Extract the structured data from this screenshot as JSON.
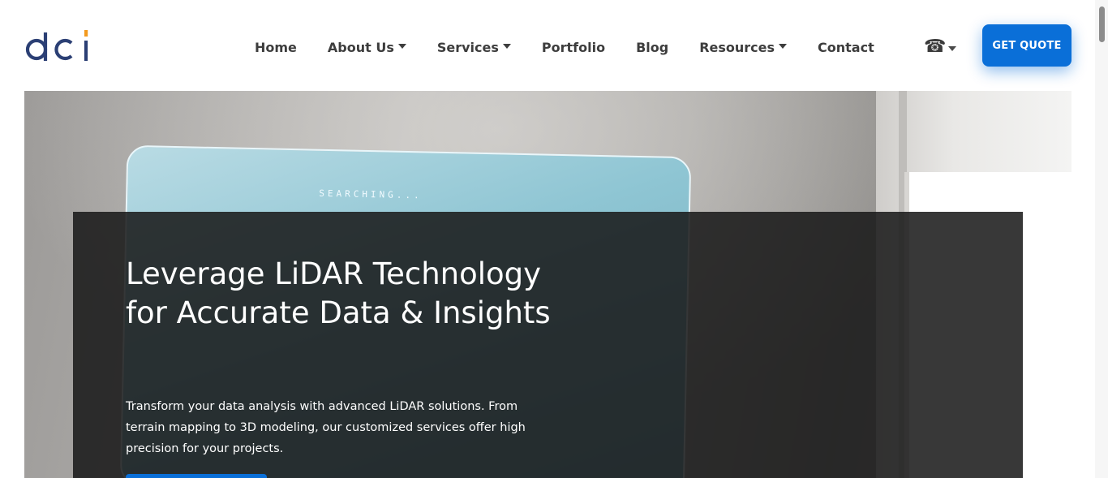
{
  "header": {
    "logo_text": "dci",
    "nav": [
      {
        "label": "Home",
        "has_dropdown": false
      },
      {
        "label": "About Us",
        "has_dropdown": true
      },
      {
        "label": "Services",
        "has_dropdown": true
      },
      {
        "label": "Portfolio",
        "has_dropdown": false
      },
      {
        "label": "Blog",
        "has_dropdown": false
      },
      {
        "label": "Resources",
        "has_dropdown": true
      },
      {
        "label": "Contact",
        "has_dropdown": false
      }
    ],
    "phone_icon": "phone-icon",
    "quote_button": "GET QUOTE"
  },
  "hero": {
    "screen_text": "SEARCHING...",
    "title": "Leverage LiDAR Technology for Accurate Data & Insights",
    "description": "Transform your data analysis with advanced LiDAR solutions. From terrain mapping to 3D modeling, our customized services offer high precision for your projects."
  },
  "colors": {
    "accent": "#0a6fd8",
    "logo_blue": "#2b3f74",
    "logo_orange": "#f39a1e",
    "overlay": "#171717"
  }
}
